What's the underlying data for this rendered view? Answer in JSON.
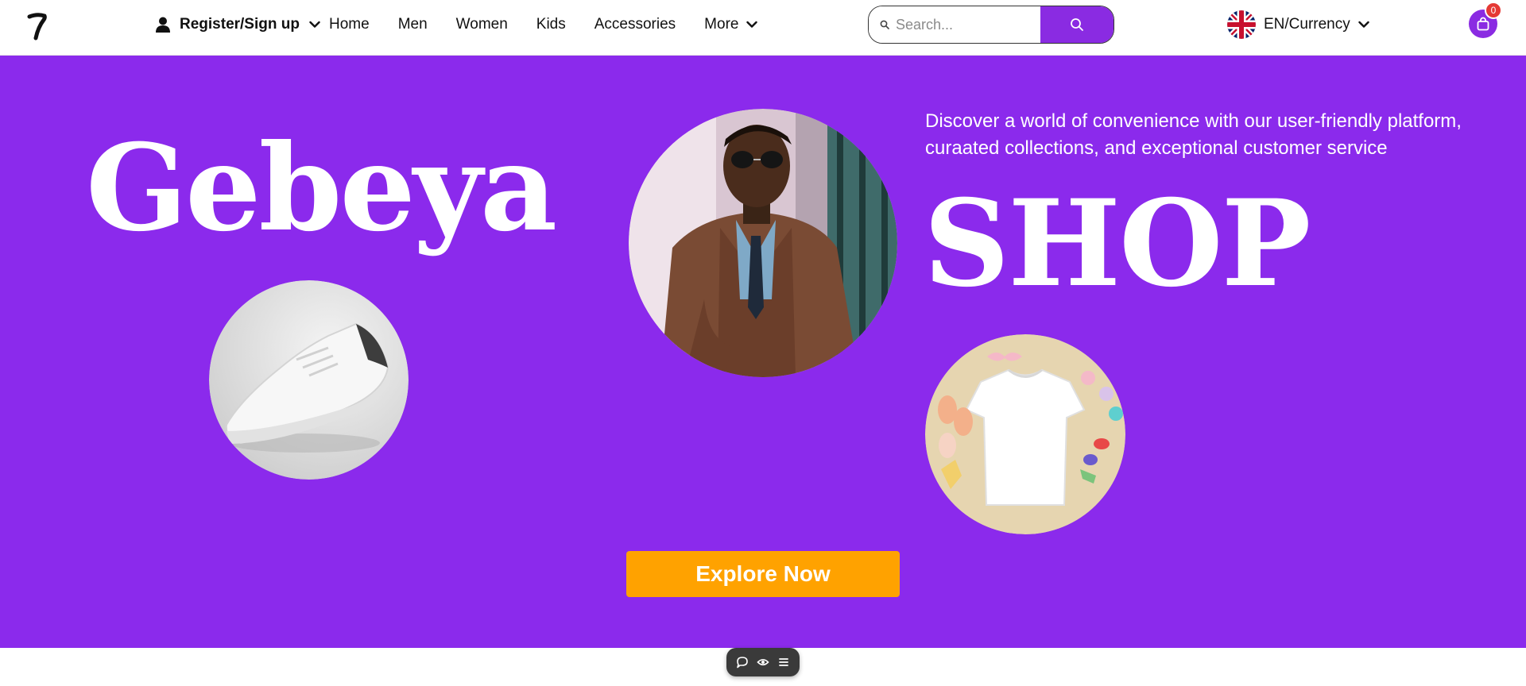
{
  "header": {
    "account_label": "Register/Sign up",
    "nav_items": [
      "Home",
      "Men",
      "Women",
      "Kids",
      "Accessories"
    ],
    "more_label": "More",
    "search": {
      "placeholder": "Search..."
    },
    "language_label": "EN/Currency",
    "cart_count": "0"
  },
  "hero": {
    "brand": "Gebeya",
    "shop": "SHOP",
    "tagline": "Discover a world of convenience with our user-friendly platform, curaated collections, and exceptional customer service",
    "cta_label": "Explore Now",
    "background_color": "#8b2aec",
    "cta_color": "#ffa200"
  },
  "toolbar": {
    "icons": [
      "chat-icon",
      "eye-icon",
      "menu-icon"
    ]
  }
}
